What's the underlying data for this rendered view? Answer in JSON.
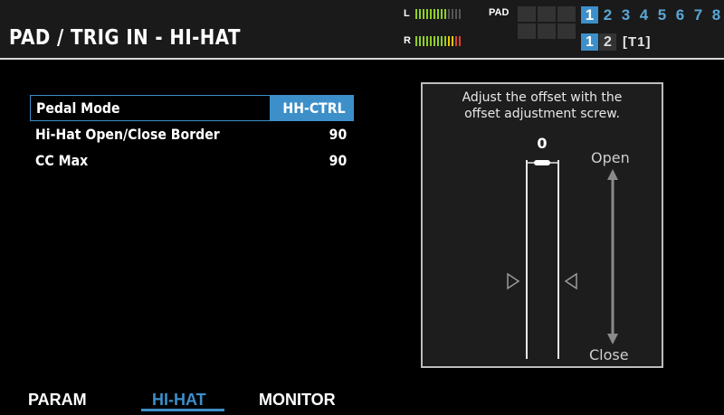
{
  "header": {
    "title": "PAD / TRIG IN - HI-HAT",
    "meters": {
      "left_label": "L",
      "right_label": "R"
    },
    "pad_label": "PAD",
    "kit_numbers": [
      "1",
      "2",
      "3",
      "4",
      "5",
      "6",
      "7",
      "8"
    ],
    "trig_numbers": [
      "1",
      "2"
    ],
    "trig_tag": "[T1]"
  },
  "params": [
    {
      "name": "Pedal Mode",
      "value": "HH-CTRL"
    },
    {
      "name": "Hi-Hat Open/Close Border",
      "value": "90"
    },
    {
      "name": "CC Max",
      "value": "90"
    }
  ],
  "panel": {
    "line1": "Adjust the offset with the",
    "line2": "offset adjustment screw.",
    "offset_value": "0",
    "open_label": "Open",
    "close_label": "Close"
  },
  "tabs": {
    "param": "PARAM",
    "hihat": "HI-HAT",
    "monitor": "MONITOR"
  },
  "colors": {
    "accent": "#3d8fc9",
    "meter_green": "#8ecf2a",
    "meter_yellow": "#e8c800",
    "meter_red": "#e0402c"
  }
}
